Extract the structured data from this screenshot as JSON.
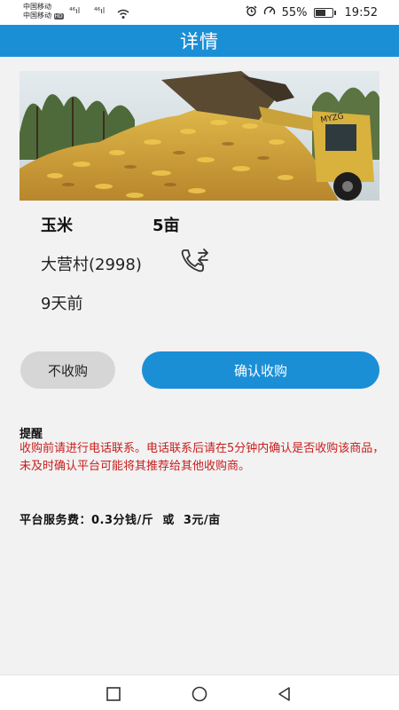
{
  "status_bar": {
    "carrier_1": "中国移动",
    "carrier_2": "中国移动",
    "network_1": "⁴⁶ıl",
    "network_2": "⁴⁶ıl",
    "battery": "55%",
    "battery_level": 0.55,
    "time": "19:52"
  },
  "header": {
    "title": "详情"
  },
  "product": {
    "name": "玉米",
    "area": "5亩",
    "village": "大营村(2998)",
    "posted": "9天前"
  },
  "actions": {
    "reject_label": "不收购",
    "confirm_label": "确认收购"
  },
  "notice": {
    "title": "提醒",
    "body": "收购前请进行电话联系。电话联系后请在5分钟内确认是否收购该商品，未及时确认平台可能将其推荐给其他收购商。"
  },
  "fee": {
    "text": "平台服务费：0.3分钱/斤  或  3元/亩"
  },
  "colors": {
    "primary": "#1b8fd6",
    "warning": "#c81e1e",
    "reject_bg": "#d6d6d6"
  },
  "icons": [
    "alarm-icon",
    "speedometer-icon",
    "battery-icon",
    "wifi-icon",
    "phone-transfer-icon",
    "nav-recents-icon",
    "nav-home-icon",
    "nav-back-icon"
  ]
}
